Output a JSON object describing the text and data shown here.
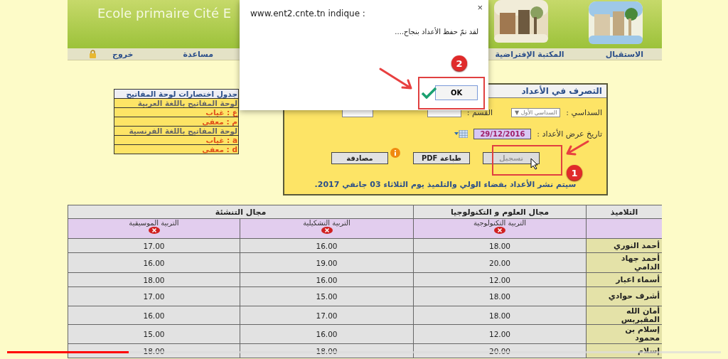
{
  "header": {
    "title": "Ecole primaire Cité E"
  },
  "nav": [
    {
      "label": "الاستقبال"
    },
    {
      "label": "المكتبة الإفتراضية"
    },
    {
      "label": "مساعدة"
    },
    {
      "label": "خروج"
    }
  ],
  "shortcuts": {
    "title": "جدول اختصارات لوحة المفاتيح",
    "rows": [
      {
        "kind": "heading",
        "text": "لوحة المفاتيح باللغة العربية"
      },
      {
        "kind": "entry",
        "text": "ع : غياب"
      },
      {
        "kind": "entry",
        "text": "م : معفى"
      },
      {
        "kind": "heading",
        "text": "لوحة المفاتيح باللغة الفرنسية"
      },
      {
        "kind": "entry",
        "text": "a : غياب"
      },
      {
        "kind": "entry",
        "text": "d : معفى"
      }
    ]
  },
  "panel": {
    "title": "التصرف في الأعداد",
    "semester_label": "السداسي :",
    "semester_value": "السداسي الأول ▼",
    "class_label": "القسم :",
    "date_label": "تاريخ عرض الأعداد :",
    "date_value": "29/12/2016",
    "buttons": [
      {
        "label": "تسجيل",
        "disabled": true
      },
      {
        "label": "طباعة PDF",
        "disabled": false
      },
      {
        "label": "مصادقة",
        "disabled": false
      }
    ],
    "notice": "سيتم نشر الأعداد بفضاء الولي والتلميذ يوم الثلاثاء 03 جانفي 2017."
  },
  "dialog": {
    "title": "www.ent2.cnte.tn indique :",
    "message": "لقد تمّ حفظ الأعداد بنجاح....",
    "close": "×",
    "ok": "OK"
  },
  "annotations": [
    {
      "number": "2"
    },
    {
      "number": "1"
    }
  ],
  "table": {
    "student_header": "التلاميذ",
    "groups": [
      "مجال العلوم و التكنولوجيا",
      "مجال التنشئة"
    ],
    "subjects": [
      "التربية التكنولوجية",
      "التربية التشكيلية",
      "التربية الموسيقية"
    ],
    "rows": [
      {
        "name": "أحمد النوري",
        "grades": [
          "18.00",
          "16.00",
          "17.00"
        ]
      },
      {
        "name": "أحمد جهاد الدامي",
        "grades": [
          "20.00",
          "19.00",
          "16.00"
        ]
      },
      {
        "name": "أسماء اعبار",
        "grades": [
          "12.00",
          "16.00",
          "18.00"
        ]
      },
      {
        "name": "أشرف حوادي",
        "grades": [
          "18.00",
          "15.00",
          "17.00"
        ]
      },
      {
        "name": "أمان الله المقبربس",
        "grades": [
          "18.00",
          "17.00",
          "16.00"
        ]
      },
      {
        "name": "إسلام بن محمود",
        "grades": [
          "12.00",
          "16.00",
          "15.00"
        ]
      },
      {
        "name": "إسلام",
        "grades": [
          "20.00",
          "18.00",
          "18.00"
        ]
      }
    ]
  },
  "video_progress": {
    "level": 0.17
  }
}
